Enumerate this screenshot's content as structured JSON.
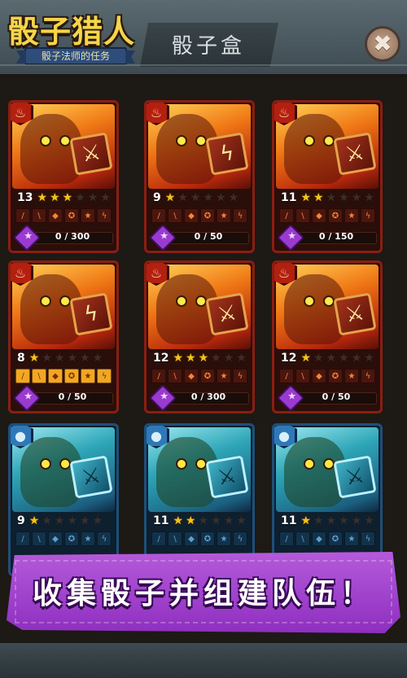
{
  "header": {
    "logo_title": "骰子猎人",
    "logo_subtitle": "骰子法师的任务",
    "page_title": "骰子盒",
    "close_label": "✖"
  },
  "cards": [
    {
      "element": "fire",
      "level": "13",
      "stars": 3,
      "max_stars": 6,
      "progress": "0 / 300",
      "dice_icon": "sword-icon",
      "skills_gold": [
        false,
        false,
        false,
        false,
        false,
        false
      ]
    },
    {
      "element": "fire",
      "level": "9",
      "stars": 1,
      "max_stars": 6,
      "progress": "0 / 50",
      "dice_icon": "lightning-icon",
      "skills_gold": [
        false,
        false,
        false,
        false,
        false,
        false
      ]
    },
    {
      "element": "fire",
      "level": "11",
      "stars": 2,
      "max_stars": 6,
      "progress": "0 / 150",
      "dice_icon": "sword-icon",
      "skills_gold": [
        false,
        false,
        false,
        false,
        false,
        false
      ]
    },
    {
      "element": "fire",
      "level": "8",
      "stars": 1,
      "max_stars": 6,
      "progress": "0 / 50",
      "dice_icon": "lightning-icon",
      "skills_gold": [
        true,
        true,
        true,
        true,
        true,
        true
      ]
    },
    {
      "element": "fire",
      "level": "12",
      "stars": 3,
      "max_stars": 6,
      "progress": "0 / 300",
      "dice_icon": "sword-icon",
      "skills_gold": [
        false,
        false,
        false,
        false,
        false,
        false
      ]
    },
    {
      "element": "fire",
      "level": "12",
      "stars": 1,
      "max_stars": 6,
      "progress": "0 / 50",
      "dice_icon": "sword-icon",
      "skills_gold": [
        false,
        false,
        false,
        false,
        false,
        false
      ]
    },
    {
      "element": "water",
      "level": "9",
      "stars": 1,
      "max_stars": 6,
      "progress": "",
      "dice_icon": "sword-icon",
      "skills_gold": [
        false,
        false,
        false,
        false,
        false,
        false
      ]
    },
    {
      "element": "water",
      "level": "11",
      "stars": 2,
      "max_stars": 6,
      "progress": "",
      "dice_icon": "sword-icon",
      "skills_gold": [
        false,
        false,
        false,
        false,
        false,
        false
      ]
    },
    {
      "element": "water",
      "level": "11",
      "stars": 1,
      "max_stars": 6,
      "progress": "",
      "dice_icon": "sword-icon",
      "skills_gold": [
        false,
        false,
        false,
        false,
        false,
        false
      ]
    }
  ],
  "banner": {
    "text": "收集骰子并组建队伍！"
  },
  "colors": {
    "fire_border": "#8a1e12",
    "water_border": "#1e4f7a",
    "star_on": "#f6c418",
    "banner_purple": "#a545cf"
  }
}
